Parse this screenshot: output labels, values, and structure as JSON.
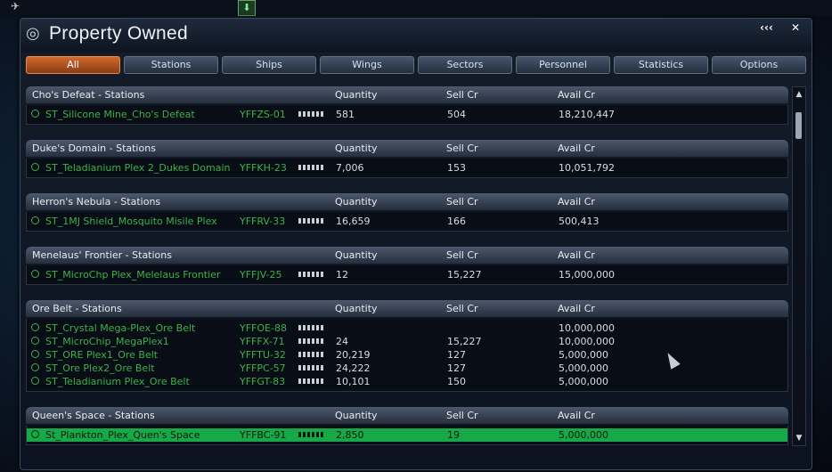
{
  "window": {
    "title": "Property Owned",
    "collapse_label": "‹‹‹",
    "close_label": "✕"
  },
  "tabs": [
    {
      "label": "All",
      "active": true
    },
    {
      "label": "Stations"
    },
    {
      "label": "Ships"
    },
    {
      "label": "Wings"
    },
    {
      "label": "Sectors"
    },
    {
      "label": "Personnel"
    },
    {
      "label": "Statistics"
    },
    {
      "label": "Options"
    }
  ],
  "columns": {
    "quantity": "Quantity",
    "sell": "Sell Cr",
    "avail": "Avail Cr"
  },
  "groups": [
    {
      "header": "Cho's Defeat - Stations",
      "rows": [
        {
          "name": "ST_Silicone Mine_Cho's Defeat",
          "code": "YFFZS-01",
          "quantity": "581",
          "sell": "504",
          "avail": "18,210,447"
        }
      ]
    },
    {
      "header": "Duke's Domain - Stations",
      "rows": [
        {
          "name": "ST_Teladianium Plex 2_Dukes Domain",
          "code": "YFFKH-23",
          "quantity": "7,006",
          "sell": "153",
          "avail": "10,051,792"
        }
      ]
    },
    {
      "header": "Herron's Nebula - Stations",
      "rows": [
        {
          "name": "ST_1MJ Shield_Mosquito Misile Plex",
          "code": "YFFRV-33",
          "quantity": "16,659",
          "sell": "166",
          "avail": "500,413"
        }
      ]
    },
    {
      "header": "Menelaus' Frontier - Stations",
      "rows": [
        {
          "name": "ST_MicroChp Plex_Melelaus Frontier",
          "code": "YFFJV-25",
          "quantity": "12",
          "sell": "15,227",
          "avail": "15,000,000"
        }
      ]
    },
    {
      "header": "Ore Belt - Stations",
      "rows": [
        {
          "name": "ST_Crystal Mega-Plex_Ore Belt",
          "code": "YFFOE-88",
          "quantity": "",
          "sell": "",
          "avail": "10,000,000"
        },
        {
          "name": "ST_MicroChip_MegaPlex1",
          "code": "YFFFX-71",
          "quantity": "24",
          "sell": "15,227",
          "avail": "10,000,000"
        },
        {
          "name": "ST_ORE Plex1_Ore Belt",
          "code": "YFFTU-32",
          "quantity": "20,219",
          "sell": "127",
          "avail": "5,000,000"
        },
        {
          "name": "ST_Ore Plex2_Ore Belt",
          "code": "YFFPC-57",
          "quantity": "24,222",
          "sell": "127",
          "avail": "5,000,000"
        },
        {
          "name": "ST_Teladianium Plex_Ore Belt",
          "code": "YFFGT-83",
          "quantity": "10,101",
          "sell": "150",
          "avail": "5,000,000"
        }
      ]
    },
    {
      "header": "Queen's Space - Stations",
      "rows": [
        {
          "name": "St_Plankton_Plex_Quen's Space",
          "code": "YFFBC-91",
          "quantity": "2,850",
          "sell": "19",
          "avail": "5,000,000",
          "selected": true
        }
      ]
    }
  ],
  "colors": {
    "accent": "#d06a2c",
    "selected": "#17a847",
    "station_text": "#3fb04a"
  }
}
